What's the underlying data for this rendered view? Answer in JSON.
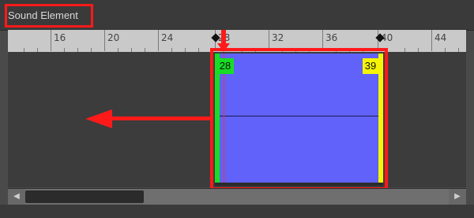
{
  "panel": {
    "title": "Sound Element"
  },
  "ruler": {
    "ticks": [
      "16",
      "20",
      "24",
      "28",
      "32",
      "36",
      "40",
      "44"
    ]
  },
  "clip": {
    "start_frame": "28",
    "end_frame": "39",
    "colors": {
      "body": "#6062fa",
      "start": "#17dd24",
      "end": "#f5f500",
      "annotation": "#ff1a1a"
    }
  },
  "scrollbar": {
    "left_arrow": "◀",
    "right_arrow": "▶"
  },
  "icons": {
    "markers": [
      "keyframe-marker-icon",
      "keyframe-marker-icon"
    ],
    "annotations": [
      "arrow-down-icon",
      "arrow-left-icon"
    ]
  }
}
